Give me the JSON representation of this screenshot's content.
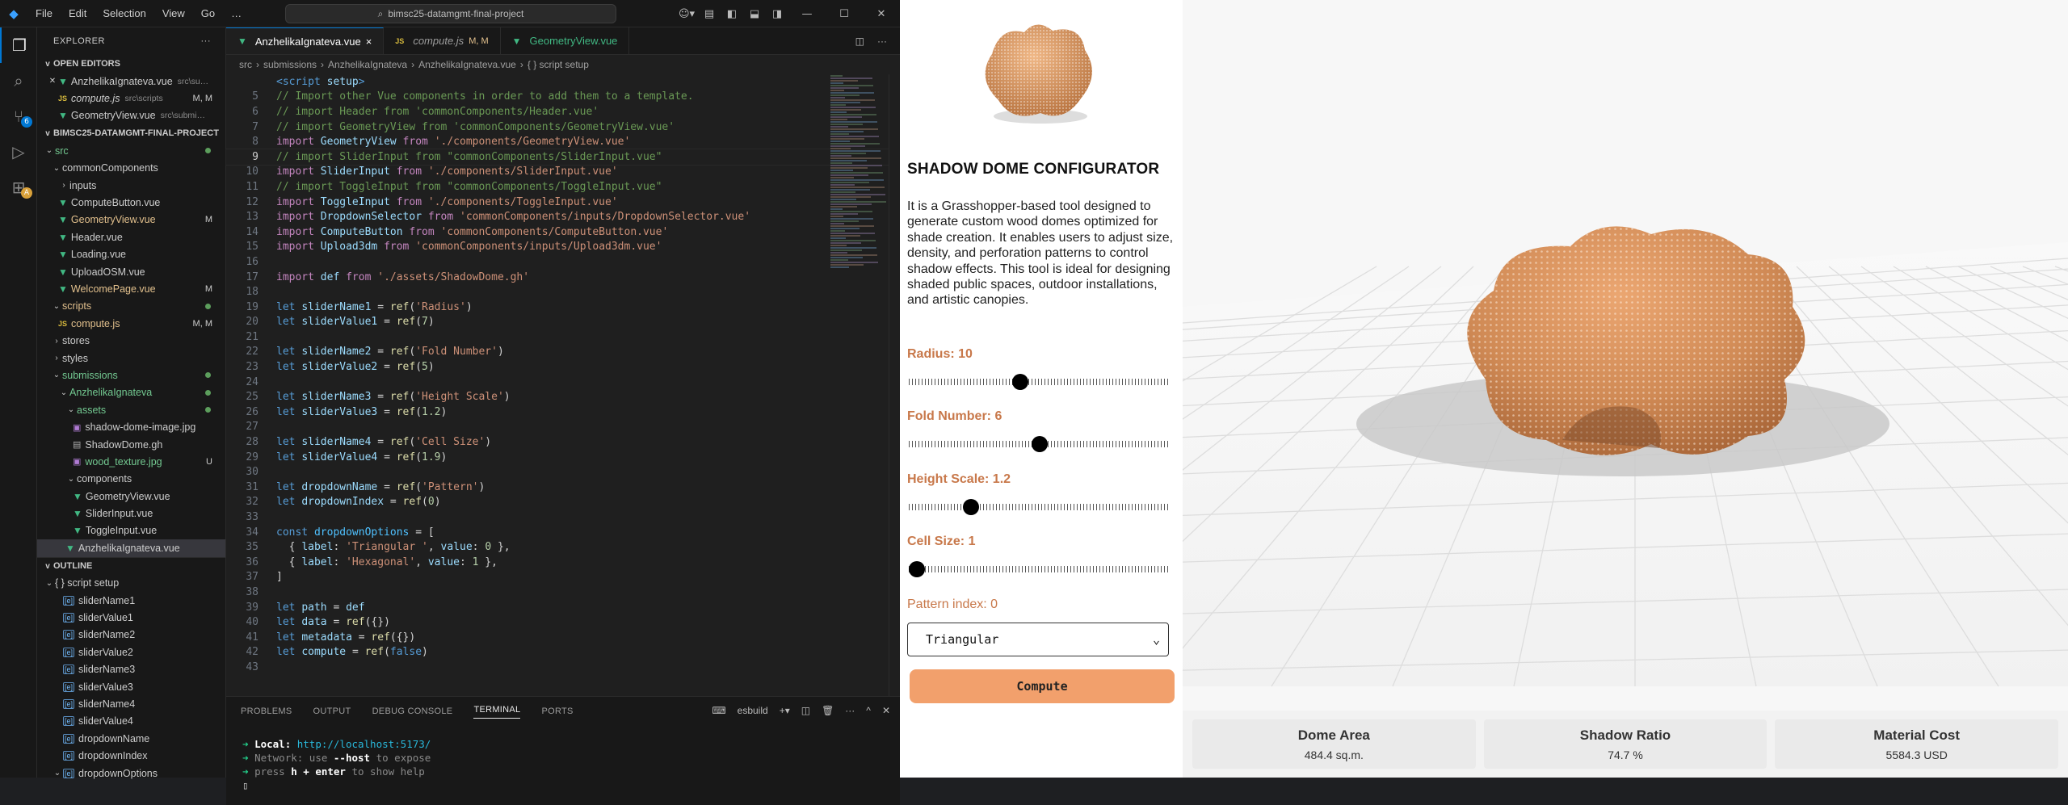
{
  "window": {
    "menus": [
      "File",
      "Edit",
      "Selection",
      "View",
      "Go",
      "…"
    ],
    "search": "bimsc25-datamgmt-final-project"
  },
  "explorer": {
    "title": "EXPLORER",
    "open_editors_label": "OPEN EDITORS",
    "open_editors": [
      {
        "name": "AnzhelikaIgnateva.vue",
        "path": "src\\su…",
        "icon": "vue",
        "close": true
      },
      {
        "name": "compute.js",
        "path": "src\\scripts",
        "status": "M, M",
        "icon": "js",
        "italic": true
      },
      {
        "name": "GeometryView.vue",
        "path": "src\\submi…",
        "icon": "vue"
      }
    ],
    "project_label": "BIMSC25-DATAMGMT-FINAL-PROJECT",
    "tree": [
      {
        "depth": 0,
        "fold": "v",
        "name": "src",
        "color": "green",
        "dot": true
      },
      {
        "depth": 1,
        "fold": "v",
        "name": "commonComponents"
      },
      {
        "depth": 2,
        "fold": ">",
        "name": "inputs"
      },
      {
        "depth": 2,
        "icon": "vue",
        "name": "ComputeButton.vue"
      },
      {
        "depth": 2,
        "icon": "vue",
        "name": "GeometryView.vue",
        "status": "M",
        "color": "yel"
      },
      {
        "depth": 2,
        "icon": "vue",
        "name": "Header.vue"
      },
      {
        "depth": 2,
        "icon": "vue",
        "name": "Loading.vue"
      },
      {
        "depth": 2,
        "icon": "vue",
        "name": "UploadOSM.vue"
      },
      {
        "depth": 2,
        "icon": "vue",
        "name": "WelcomePage.vue",
        "status": "M",
        "color": "yel"
      },
      {
        "depth": 1,
        "fold": "v",
        "name": "scripts",
        "color": "yel",
        "dot": true
      },
      {
        "depth": 2,
        "icon": "js",
        "name": "compute.js",
        "status": "M, M",
        "color": "yel"
      },
      {
        "depth": 1,
        "fold": ">",
        "name": "stores"
      },
      {
        "depth": 1,
        "fold": ">",
        "name": "styles"
      },
      {
        "depth": 1,
        "fold": "v",
        "name": "submissions",
        "color": "green",
        "dot": true
      },
      {
        "depth": 2,
        "fold": "v",
        "name": "AnzhelikaIgnateva",
        "color": "green",
        "dot": true
      },
      {
        "depth": 3,
        "fold": "v",
        "name": "assets",
        "color": "green",
        "dot": true
      },
      {
        "depth": 4,
        "icon": "img",
        "name": "shadow-dome-image.jpg"
      },
      {
        "depth": 4,
        "icon": "gh",
        "name": "ShadowDome.gh"
      },
      {
        "depth": 4,
        "icon": "img",
        "name": "wood_texture.jpg",
        "status": "U",
        "color": "green"
      },
      {
        "depth": 3,
        "fold": "v",
        "name": "components"
      },
      {
        "depth": 4,
        "icon": "vue",
        "name": "GeometryView.vue"
      },
      {
        "depth": 4,
        "icon": "vue",
        "name": "SliderInput.vue"
      },
      {
        "depth": 4,
        "icon": "vue",
        "name": "ToggleInput.vue"
      },
      {
        "depth": 3,
        "icon": "vue",
        "name": "AnzhelikaIgnateva.vue",
        "selected": true
      }
    ],
    "outline_label": "OUTLINE",
    "outline": [
      {
        "depth": 0,
        "fold": "v",
        "name": "{ } script setup",
        "sym": false
      },
      {
        "depth": 1,
        "name": "sliderName1"
      },
      {
        "depth": 1,
        "name": "sliderValue1"
      },
      {
        "depth": 1,
        "name": "sliderName2"
      },
      {
        "depth": 1,
        "name": "sliderValue2"
      },
      {
        "depth": 1,
        "name": "sliderName3"
      },
      {
        "depth": 1,
        "name": "sliderValue3"
      },
      {
        "depth": 1,
        "name": "sliderName4"
      },
      {
        "depth": 1,
        "name": "sliderValue4"
      },
      {
        "depth": 1,
        "name": "dropdownName"
      },
      {
        "depth": 1,
        "name": "dropdownIndex"
      },
      {
        "depth": 1,
        "fold": "v",
        "name": "dropdownOptions"
      }
    ]
  },
  "tabs": [
    {
      "name": "AnzhelikaIgnateva.vue",
      "icon": "vue",
      "active": true,
      "close": "×"
    },
    {
      "name": "compute.js",
      "icon": "js",
      "status": "M, M",
      "italic": true
    },
    {
      "name": "GeometryView.vue",
      "icon": "vue"
    }
  ],
  "breadcrumb": [
    "src",
    "submissions",
    "AnzhelikaIgnateva",
    "AnzhelikaIgnateva.vue",
    "{ } script setup"
  ],
  "code_lines": [
    {
      "n": "",
      "t": [
        [
          "c-tag",
          "<script "
        ],
        [
          "c-attr",
          "setup"
        ],
        [
          "c-tag",
          ">"
        ]
      ]
    },
    {
      "n": "5",
      "t": [
        [
          "c-cm",
          "// Import other Vue components in order to add them to a template."
        ]
      ]
    },
    {
      "n": "6",
      "t": [
        [
          "c-cm",
          "// import Header from 'commonComponents/Header.vue'"
        ]
      ]
    },
    {
      "n": "7",
      "t": [
        [
          "c-cm",
          "// import GeometryView from 'commonComponents/GeometryView.vue'"
        ]
      ]
    },
    {
      "n": "8",
      "t": [
        [
          "c-kw",
          "import "
        ],
        [
          "c-var",
          "GeometryView "
        ],
        [
          "c-kw",
          "from "
        ],
        [
          "c-str",
          "'./components/GeometryView.vue'"
        ]
      ]
    },
    {
      "n": "9",
      "cur": true,
      "t": [
        [
          "c-cm",
          "// import SliderInput from \"commonComponents/SliderInput.vue\""
        ]
      ]
    },
    {
      "n": "10",
      "t": [
        [
          "c-kw",
          "import "
        ],
        [
          "c-var",
          "SliderInput "
        ],
        [
          "c-kw",
          "from "
        ],
        [
          "c-str",
          "'./components/SliderInput.vue'"
        ]
      ]
    },
    {
      "n": "11",
      "t": [
        [
          "c-cm",
          "// import ToggleInput from \"commonComponents/ToggleInput.vue\""
        ]
      ]
    },
    {
      "n": "12",
      "t": [
        [
          "c-kw",
          "import "
        ],
        [
          "c-var",
          "ToggleInput "
        ],
        [
          "c-kw",
          "from "
        ],
        [
          "c-str",
          "'./components/ToggleInput.vue'"
        ]
      ]
    },
    {
      "n": "13",
      "t": [
        [
          "c-kw",
          "import "
        ],
        [
          "c-var",
          "DropdownSelector "
        ],
        [
          "c-kw",
          "from "
        ],
        [
          "c-str",
          "'commonComponents/inputs/DropdownSelector.vue'"
        ]
      ]
    },
    {
      "n": "14",
      "t": [
        [
          "c-kw",
          "import "
        ],
        [
          "c-var",
          "ComputeButton "
        ],
        [
          "c-kw",
          "from "
        ],
        [
          "c-str",
          "'commonComponents/ComputeButton.vue'"
        ]
      ]
    },
    {
      "n": "15",
      "t": [
        [
          "c-kw",
          "import "
        ],
        [
          "c-var",
          "Upload3dm "
        ],
        [
          "c-kw",
          "from "
        ],
        [
          "c-str",
          "'commonComponents/inputs/Upload3dm.vue'"
        ]
      ]
    },
    {
      "n": "16",
      "t": []
    },
    {
      "n": "17",
      "t": [
        [
          "c-kw",
          "import "
        ],
        [
          "c-var",
          "def "
        ],
        [
          "c-kw",
          "from "
        ],
        [
          "c-str",
          "'./assets/ShadowDome.gh'"
        ]
      ]
    },
    {
      "n": "18",
      "t": []
    },
    {
      "n": "19",
      "t": [
        [
          "c-kw2",
          "let "
        ],
        [
          "c-var",
          "sliderName1 "
        ],
        [
          "ct",
          "= "
        ],
        [
          "c-fn",
          "ref"
        ],
        [
          "ct",
          "("
        ],
        [
          "c-str",
          "'Radius'"
        ],
        [
          "ct",
          ")"
        ]
      ]
    },
    {
      "n": "20",
      "t": [
        [
          "c-kw2",
          "let "
        ],
        [
          "c-var",
          "sliderValue1 "
        ],
        [
          "ct",
          "= "
        ],
        [
          "c-fn",
          "ref"
        ],
        [
          "ct",
          "("
        ],
        [
          "c-num",
          "7"
        ],
        [
          "ct",
          ")"
        ]
      ]
    },
    {
      "n": "21",
      "t": []
    },
    {
      "n": "22",
      "t": [
        [
          "c-kw2",
          "let "
        ],
        [
          "c-var",
          "sliderName2 "
        ],
        [
          "ct",
          "= "
        ],
        [
          "c-fn",
          "ref"
        ],
        [
          "ct",
          "("
        ],
        [
          "c-str",
          "'Fold Number'"
        ],
        [
          "ct",
          ")"
        ]
      ]
    },
    {
      "n": "23",
      "t": [
        [
          "c-kw2",
          "let "
        ],
        [
          "c-var",
          "sliderValue2 "
        ],
        [
          "ct",
          "= "
        ],
        [
          "c-fn",
          "ref"
        ],
        [
          "ct",
          "("
        ],
        [
          "c-num",
          "5"
        ],
        [
          "ct",
          ")"
        ]
      ]
    },
    {
      "n": "24",
      "t": []
    },
    {
      "n": "25",
      "t": [
        [
          "c-kw2",
          "let "
        ],
        [
          "c-var",
          "sliderName3 "
        ],
        [
          "ct",
          "= "
        ],
        [
          "c-fn",
          "ref"
        ],
        [
          "ct",
          "("
        ],
        [
          "c-str",
          "'Height Scale'"
        ],
        [
          "ct",
          ")"
        ]
      ]
    },
    {
      "n": "26",
      "t": [
        [
          "c-kw2",
          "let "
        ],
        [
          "c-var",
          "sliderValue3 "
        ],
        [
          "ct",
          "= "
        ],
        [
          "c-fn",
          "ref"
        ],
        [
          "ct",
          "("
        ],
        [
          "c-num",
          "1.2"
        ],
        [
          "ct",
          ")"
        ]
      ]
    },
    {
      "n": "27",
      "t": []
    },
    {
      "n": "28",
      "t": [
        [
          "c-kw2",
          "let "
        ],
        [
          "c-var",
          "sliderName4 "
        ],
        [
          "ct",
          "= "
        ],
        [
          "c-fn",
          "ref"
        ],
        [
          "ct",
          "("
        ],
        [
          "c-str",
          "'Cell Size'"
        ],
        [
          "ct",
          ")"
        ]
      ]
    },
    {
      "n": "29",
      "t": [
        [
          "c-kw2",
          "let "
        ],
        [
          "c-var",
          "sliderValue4 "
        ],
        [
          "ct",
          "= "
        ],
        [
          "c-fn",
          "ref"
        ],
        [
          "ct",
          "("
        ],
        [
          "c-num",
          "1.9"
        ],
        [
          "ct",
          ")"
        ]
      ]
    },
    {
      "n": "30",
      "t": []
    },
    {
      "n": "31",
      "t": [
        [
          "c-kw2",
          "let "
        ],
        [
          "c-var",
          "dropdownName "
        ],
        [
          "ct",
          "= "
        ],
        [
          "c-fn",
          "ref"
        ],
        [
          "ct",
          "("
        ],
        [
          "c-str",
          "'Pattern'"
        ],
        [
          "ct",
          ")"
        ]
      ]
    },
    {
      "n": "32",
      "t": [
        [
          "c-kw2",
          "let "
        ],
        [
          "c-var",
          "dropdownIndex "
        ],
        [
          "ct",
          "= "
        ],
        [
          "c-fn",
          "ref"
        ],
        [
          "ct",
          "("
        ],
        [
          "c-num",
          "0"
        ],
        [
          "ct",
          ")"
        ]
      ]
    },
    {
      "n": "33",
      "t": []
    },
    {
      "n": "34",
      "t": [
        [
          "c-kw2",
          "const "
        ],
        [
          "c-const",
          "dropdownOptions "
        ],
        [
          "ct",
          "= ["
        ]
      ]
    },
    {
      "n": "35",
      "t": [
        [
          "ct",
          "  { "
        ],
        [
          "c-var",
          "label"
        ],
        [
          "ct",
          ": "
        ],
        [
          "c-str",
          "'Triangular '"
        ],
        [
          "ct",
          ", "
        ],
        [
          "c-var",
          "value"
        ],
        [
          "ct",
          ": "
        ],
        [
          "c-num",
          "0"
        ],
        [
          "ct",
          " },"
        ]
      ]
    },
    {
      "n": "36",
      "t": [
        [
          "ct",
          "  { "
        ],
        [
          "c-var",
          "label"
        ],
        [
          "ct",
          ": "
        ],
        [
          "c-str",
          "'Hexagonal'"
        ],
        [
          "ct",
          ", "
        ],
        [
          "c-var",
          "value"
        ],
        [
          "ct",
          ": "
        ],
        [
          "c-num",
          "1"
        ],
        [
          "ct",
          " },"
        ]
      ]
    },
    {
      "n": "37",
      "t": [
        [
          "ct",
          "]"
        ]
      ]
    },
    {
      "n": "38",
      "t": []
    },
    {
      "n": "39",
      "t": [
        [
          "c-kw2",
          "let "
        ],
        [
          "c-var",
          "path "
        ],
        [
          "ct",
          "= "
        ],
        [
          "c-var",
          "def"
        ]
      ]
    },
    {
      "n": "40",
      "t": [
        [
          "c-kw2",
          "let "
        ],
        [
          "c-var",
          "data "
        ],
        [
          "ct",
          "= "
        ],
        [
          "c-fn",
          "ref"
        ],
        [
          "ct",
          "({})"
        ]
      ]
    },
    {
      "n": "41",
      "t": [
        [
          "c-kw2",
          "let "
        ],
        [
          "c-var",
          "metadata "
        ],
        [
          "ct",
          "= "
        ],
        [
          "c-fn",
          "ref"
        ],
        [
          "ct",
          "({})"
        ]
      ]
    },
    {
      "n": "42",
      "t": [
        [
          "c-kw2",
          "let "
        ],
        [
          "c-var",
          "compute "
        ],
        [
          "ct",
          "= "
        ],
        [
          "c-fn",
          "ref"
        ],
        [
          "ct",
          "("
        ],
        [
          "c-kw2",
          "false"
        ],
        [
          "ct",
          ")"
        ]
      ]
    },
    {
      "n": "43",
      "t": []
    }
  ],
  "panel": {
    "tabs": [
      "PROBLEMS",
      "OUTPUT",
      "DEBUG CONSOLE",
      "TERMINAL",
      "PORTS"
    ],
    "active": "TERMINAL",
    "shell": "esbuild",
    "local_label": "Local:",
    "local_url": "http://localhost:5173/",
    "network_line_a": "Network: use ",
    "network_flag": "--host",
    "network_line_b": " to expose",
    "help_a": "press ",
    "help_key": "h + enter",
    "help_b": " to show help"
  },
  "app": {
    "title": "SHADOW DOME CONFIGURATOR",
    "description": "It is a Grasshopper-based tool designed to generate custom wood domes optimized for shade creation. It enables users to adjust size, density, and perforation patterns to control shadow effects. This tool is ideal for designing shaded public spaces, outdoor installations, and artistic canopies.",
    "sliders": [
      {
        "label": "Radius: 10",
        "fraction": 0.42
      },
      {
        "label": "Fold Number: 6",
        "fraction": 0.5
      },
      {
        "label": "Height Scale: 1.2",
        "fraction": 0.22
      },
      {
        "label": "Cell Size: 1",
        "fraction": 0.0
      }
    ],
    "pattern_label": "Pattern index: 0",
    "pattern_selected": "Triangular",
    "compute_label": "Compute",
    "stats": [
      {
        "name": "Dome Area",
        "value": "484.4 sq.m."
      },
      {
        "name": "Shadow Ratio",
        "value": "74.7 %"
      },
      {
        "name": "Material Cost",
        "value": "5584.3 USD"
      }
    ],
    "colors": {
      "accent": "#c8784a",
      "button": "#f2a06c",
      "dome": "#d9915a"
    }
  }
}
